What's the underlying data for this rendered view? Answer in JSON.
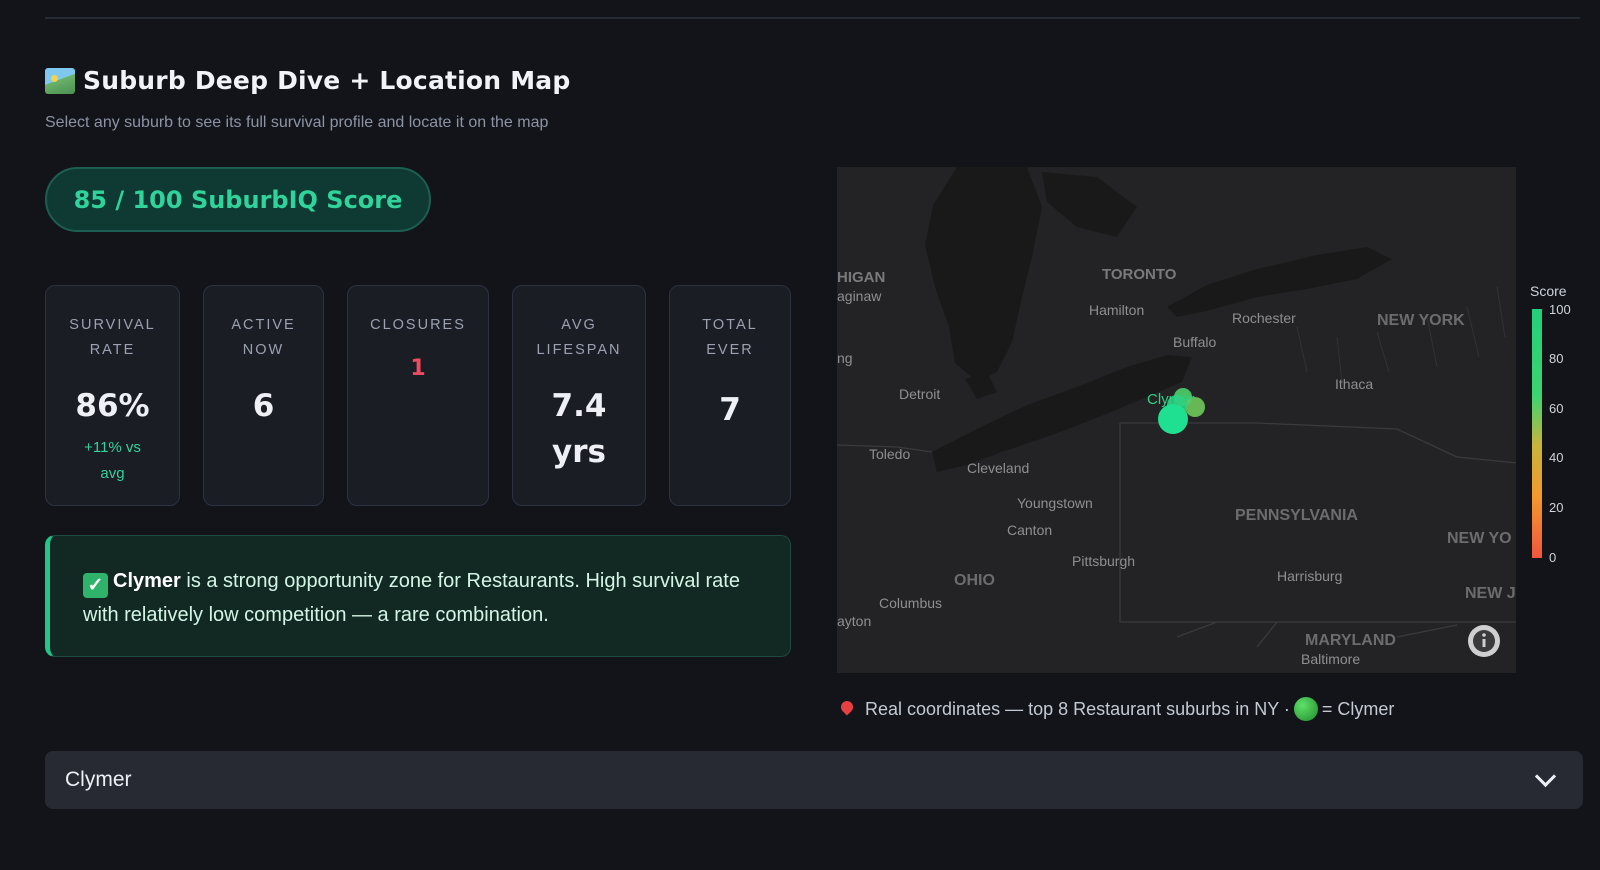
{
  "section": {
    "title": "Suburb Deep Dive + Location Map",
    "title_icon": "world-map-icon",
    "subtitle": "Select any suburb to see its full survival profile and locate it on the map"
  },
  "score": {
    "text": "85 / 100 SuburbIQ Score"
  },
  "metrics": [
    {
      "label_line1": "SURVIVAL",
      "label_line2": "RATE",
      "value": "86%",
      "delta_line1": "+11% vs",
      "delta_line2": "avg"
    },
    {
      "label_line1": "ACTIVE",
      "label_line2": "NOW",
      "value": "6"
    },
    {
      "label_line1": "CLOSURES",
      "label_line2": "",
      "value": "1"
    },
    {
      "label_line1": "AVG",
      "label_line2": "LIFESPAN",
      "value_line1": "7.4",
      "value_line2": "yrs"
    },
    {
      "label_line1": "TOTAL",
      "label_line2": "EVER",
      "value": "7"
    }
  ],
  "callout": {
    "icon": "check-mark-icon",
    "suburb": "Clymer",
    "text_line1": " is a strong opportunity zone for Restaurants. High survival rate",
    "text_line2": "with relatively low competition — a rare combination."
  },
  "map": {
    "places": {
      "michigan": "HIGAN",
      "saginaw": "aginaw",
      "toronto": "TORONTO",
      "hamilton": "Hamilton",
      "rochester": "Rochester",
      "new_york": "NEW YORK",
      "buffalo": "Buffalo",
      "ithaca": "Ithaca",
      "detroit": "Detroit",
      "toledo": "Toledo",
      "cleveland": "Cleveland",
      "youngstown": "Youngstown",
      "canton": "Canton",
      "pennsylvania": "PENNSYLVANIA",
      "pittsburgh": "Pittsburgh",
      "ohio": "OHIO",
      "harrisburg": "Harrisburg",
      "new_yo": "NEW YO",
      "columbus": "Columbus",
      "dayton": "ayton",
      "maryland": "MARYLAND",
      "baltimore": "Baltimore",
      "new_j": "NEW J",
      "lansing": "ng"
    },
    "marker_label": "Clymer",
    "colorbar": {
      "title": "Score",
      "ticks": [
        "100",
        "80",
        "60",
        "40",
        "20",
        "0"
      ]
    },
    "accent": "#22d07a"
  },
  "caption": {
    "text_before": "Real coordinates — top 8 Restaurant suburbs in NY ·",
    "text_after": "= Clymer"
  },
  "selector": {
    "selected": "Clymer"
  }
}
